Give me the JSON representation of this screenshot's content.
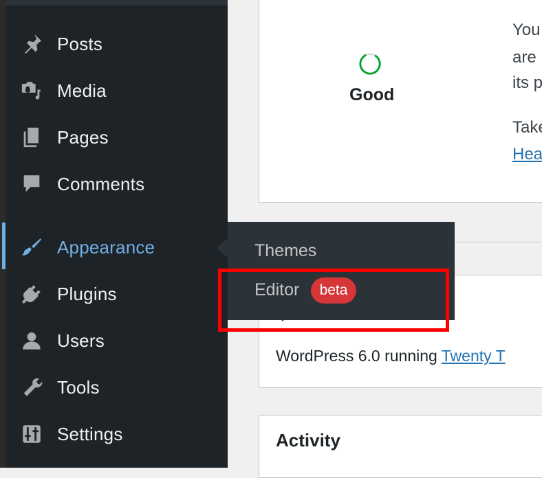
{
  "sidebar": {
    "items": [
      {
        "label": "Posts",
        "icon": "pin-icon"
      },
      {
        "label": "Media",
        "icon": "media-icon"
      },
      {
        "label": "Pages",
        "icon": "pages-icon"
      },
      {
        "label": "Comments",
        "icon": "comment-icon"
      },
      {
        "label": "Appearance",
        "icon": "brush-icon",
        "active": true
      },
      {
        "label": "Plugins",
        "icon": "plug-icon"
      },
      {
        "label": "Users",
        "icon": "user-icon"
      },
      {
        "label": "Tools",
        "icon": "wrench-icon"
      },
      {
        "label": "Settings",
        "icon": "sliders-icon"
      }
    ]
  },
  "flyout": {
    "themes_label": "Themes",
    "editor_label": "Editor",
    "editor_badge": "beta"
  },
  "site_health": {
    "status": "Good",
    "text_lines": [
      "You",
      "are",
      "its p"
    ],
    "text_take": "Take",
    "link_text": "Hea"
  },
  "at_a_glance": {
    "running_text": "WordPress 6.0 running ",
    "theme_link": "Twenty T"
  },
  "activity": {
    "title": "Activity"
  },
  "colors": {
    "accent": "#72aee6",
    "sidebar_bg": "#1d2327",
    "flyout_bg": "#2c3338",
    "badge": "#d63638",
    "highlight": "#ff0000",
    "status_good": "#00a32a"
  }
}
